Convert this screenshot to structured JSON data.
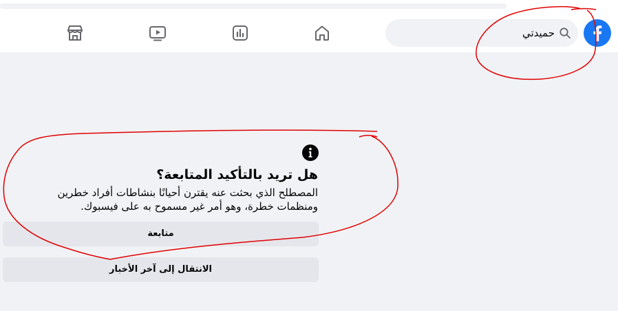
{
  "header": {
    "logo_icon": "facebook-f-icon",
    "search": {
      "value": "حميدتي",
      "icon": "search-icon"
    },
    "nav": [
      {
        "name": "home",
        "icon": "home-icon"
      },
      {
        "name": "analytics",
        "icon": "bar-chart-icon"
      },
      {
        "name": "watch",
        "icon": "video-play-icon"
      },
      {
        "name": "marketplace",
        "icon": "store-icon"
      }
    ]
  },
  "dialog": {
    "icon": "info-icon",
    "title": "هل تريد بالتأكيد المتابعة؟",
    "body": "المصطلح الذي بحثت عنه يقترن أحيانًا بنشاطات أفراد خطرين ومنظمات خطرة، وهو أمر غير مسموح به على فيسبوك.",
    "continue_label": "متابعة",
    "news_label": "الانتقال إلى آخر الأخبار"
  },
  "colors": {
    "brand": "#1877f2",
    "background": "#f0f2f5",
    "button": "#e4e6eb",
    "annotation": "#e00000"
  }
}
